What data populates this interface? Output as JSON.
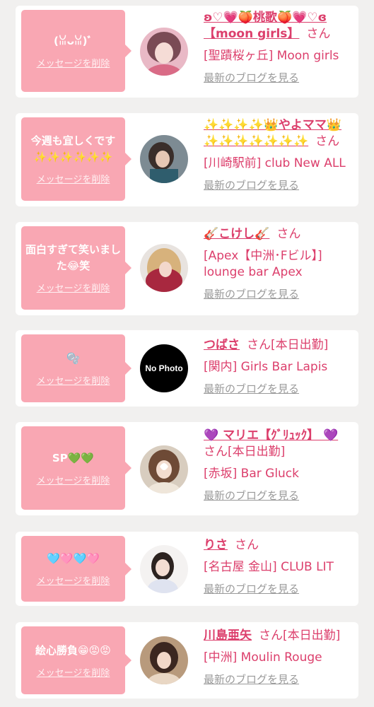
{
  "colors": {
    "accent": "#dc3f6c",
    "bubble": "#f9a7b3",
    "muted": "#9a9a9a",
    "background": "#f1f0ef"
  },
  "messages": [
    {
      "message": "(ꈍᴗꈍ)ﾞ",
      "delete_label": "メッセージを削除",
      "name": "ʚ♡💗🍑桃歌🍑💗♡ɞ【moon girls】",
      "suffix": "さん",
      "shop": "[聖蹟桜ヶ丘] Moon girls",
      "blog_label": "最新のブログを見る",
      "avatar_icon": "photo"
    },
    {
      "message": "今週も宜しくです✨✨✨✨✨✨",
      "delete_label": "メッセージを削除",
      "name": "✨✨✨✨👑やよママ👑✨✨✨✨✨✨✨",
      "suffix": "さん",
      "shop": "[川崎駅前] club New ALL",
      "blog_label": "最新のブログを見る",
      "avatar_icon": "photo"
    },
    {
      "message": "面白すぎて笑いました😂笑",
      "delete_label": "メッセージを削除",
      "name": "🎸こけし🎸",
      "suffix": "さん",
      "shop": "[Apex【中洲･Fビル】] lounge bar Apex",
      "blog_label": "最新のブログを見る",
      "avatar_icon": "photo"
    },
    {
      "message": "🫧",
      "delete_label": "メッセージを削除",
      "name": "つばさ",
      "suffix": "さん[本日出勤]",
      "shop": "[関内] Girls Bar Lapis",
      "blog_label": "最新のブログを見る",
      "avatar_icon": "no-photo",
      "avatar_text": "No Photo"
    },
    {
      "message": "SP💚💚",
      "delete_label": "メッセージを削除",
      "name": "💜 マリエ【ｸﾞﾘｭｯｸ】 💜",
      "suffix": "さん[本日出勤]",
      "shop": "[赤坂] Bar Gluck",
      "blog_label": "最新のブログを見る",
      "avatar_icon": "photo"
    },
    {
      "message": "🩵🩷🩵🩷",
      "delete_label": "メッセージを削除",
      "name": "りさ",
      "suffix": "さん",
      "shop": "[名古屋 金山] CLUB LIT",
      "blog_label": "最新のブログを見る",
      "avatar_icon": "photo"
    },
    {
      "message": "絵心勝負😁😡😡",
      "delete_label": "メッセージを削除",
      "name": "川島亜矢",
      "suffix": "さん[本日出勤]",
      "shop": "[中洲] Moulin Rouge",
      "blog_label": "最新のブログを見る",
      "avatar_icon": "photo"
    }
  ]
}
